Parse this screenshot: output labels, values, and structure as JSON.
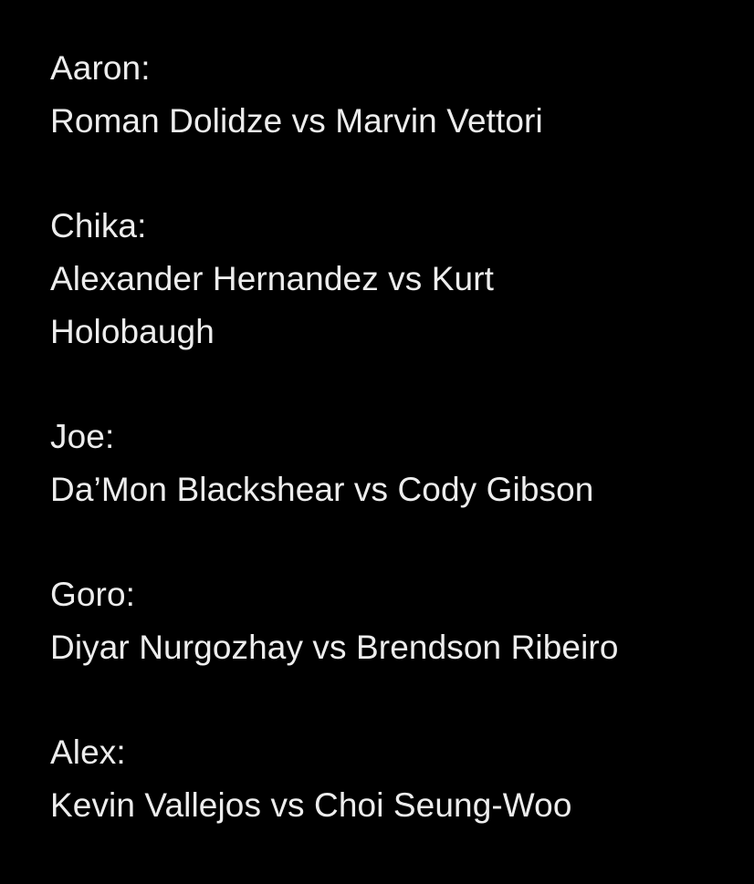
{
  "colors": {
    "background": "#000000",
    "text": "#ededed"
  },
  "note": {
    "entries": [
      {
        "name": "Aaron:",
        "matchup": "Roman Dolidze vs Marvin Vettori"
      },
      {
        "name": "Chika:",
        "matchup": "Alexander Hernandez vs Kurt Holobaugh"
      },
      {
        "name": "Joe:",
        "matchup": "Da’Mon Blackshear vs Cody Gibson"
      },
      {
        "name": "Goro:",
        "matchup": "Diyar Nurgozhay vs Brendson Ribeiro"
      },
      {
        "name": "Alex:",
        "matchup": "Kevin Vallejos vs Choi Seung-Woo"
      }
    ]
  }
}
